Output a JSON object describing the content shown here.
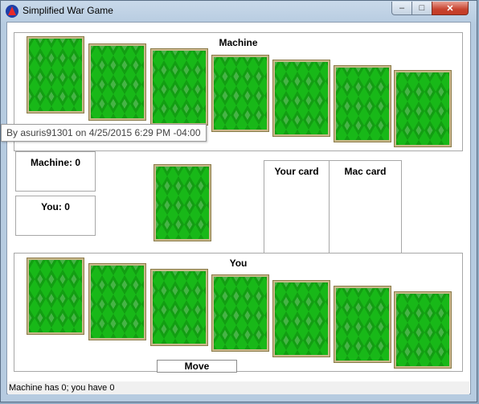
{
  "window": {
    "title": "Simplified War Game",
    "app_icon": "java-app-icon",
    "minimize_glyph": "–",
    "maximize_glyph": "□",
    "close_glyph": "✕"
  },
  "machine_panel": {
    "title": "Machine",
    "card_count": 7
  },
  "player_panel": {
    "title": "You",
    "card_count": 7
  },
  "scores": {
    "machine_label": "Machine: 0",
    "you_label": "You: 0"
  },
  "slots": {
    "your_card_label": "Your card",
    "mac_card_label": "Mac card"
  },
  "move_button": {
    "label": "Move"
  },
  "tooltip": {
    "text": "By asuris91301 on 4/25/2015 6:29 PM -04:00"
  },
  "status": {
    "text": "Machine has 0; you have 0"
  },
  "colors": {
    "card_back": "#18b818",
    "card_border": "#c9b98a",
    "close_button": "#c7432f"
  }
}
